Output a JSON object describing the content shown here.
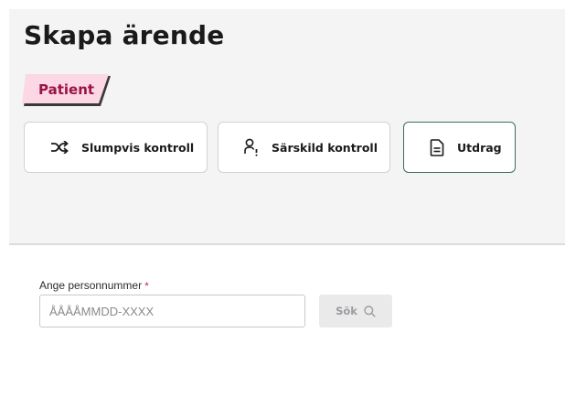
{
  "page": {
    "title": "Skapa ärende"
  },
  "patient_tag": {
    "label": "Patient",
    "color": "#9b1346",
    "bg": "#fbd8e4"
  },
  "actions": [
    {
      "label": "Slumpvis kontroll",
      "icon": "shuffle-icon"
    },
    {
      "label": "Särskild kontroll",
      "icon": "person-alert-icon"
    },
    {
      "label": "Utdrag",
      "icon": "document-icon"
    }
  ],
  "form": {
    "label": "Ange personnummer",
    "required_mark": "*",
    "placeholder": "ÅÅÅÅMMDD-XXXX",
    "value": "",
    "search_label": "Sök",
    "search_icon": "search-icon"
  },
  "colors": {
    "accent": "#3e6e5a",
    "required": "#c8102e"
  }
}
